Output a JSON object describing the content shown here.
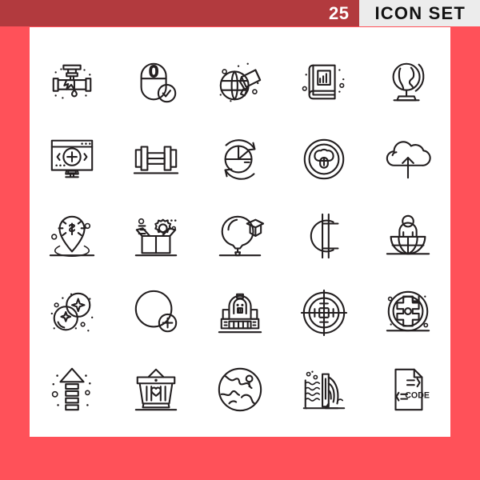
{
  "header": {
    "count": "25",
    "title": "ICON SET",
    "count_bg": "#b23a3e",
    "title_bg": "#ececec",
    "title_color": "#121212"
  },
  "page": {
    "background_color": "#ff5159",
    "panel_color": "#ffffff",
    "icon_stroke_color": "#231f20"
  },
  "grid": {
    "columns": 5,
    "rows": 5,
    "total_icons": 25
  },
  "icons": [
    {
      "index": 1,
      "name": "broken-pipe-leak-icon",
      "label": "Broken Pipe Leak"
    },
    {
      "index": 2,
      "name": "mouse-check-icon",
      "label": "Computer Mouse Verified"
    },
    {
      "index": 3,
      "name": "globe-megaphone-icon",
      "label": "Global Announcement"
    },
    {
      "index": 4,
      "name": "book-chart-icon",
      "label": "Statistics Book"
    },
    {
      "index": 5,
      "name": "desk-globe-icon",
      "label": "Desk Globe"
    },
    {
      "index": 6,
      "name": "monitor-add-icon",
      "label": "Monitor Add"
    },
    {
      "index": 7,
      "name": "dumbbell-icon",
      "label": "Dumbbell"
    },
    {
      "index": 8,
      "name": "pie-chart-refresh-icon",
      "label": "Pie Chart Refresh"
    },
    {
      "index": 9,
      "name": "face-coin-icon",
      "label": "Circular Face Badge"
    },
    {
      "index": 10,
      "name": "cloud-upload-icon",
      "label": "Cloud Upload"
    },
    {
      "index": 11,
      "name": "dollar-location-pin-icon",
      "label": "Money Location"
    },
    {
      "index": 12,
      "name": "box-gear-icon",
      "label": "Package Settings"
    },
    {
      "index": 13,
      "name": "balloon-graduation-icon",
      "label": "Graduation Balloon"
    },
    {
      "index": 14,
      "name": "cent-currency-icon",
      "label": "Cent Currency"
    },
    {
      "index": 15,
      "name": "person-globe-desk-icon",
      "label": "Global Worker"
    },
    {
      "index": 16,
      "name": "sparkle-bubbles-icon",
      "label": "Sparkling Bubbles"
    },
    {
      "index": 17,
      "name": "circle-add-icon",
      "label": "Add Circle"
    },
    {
      "index": 18,
      "name": "robot-machine-icon",
      "label": "Robot Machine"
    },
    {
      "index": 19,
      "name": "crosshair-target-icon",
      "label": "Crosshair Target"
    },
    {
      "index": 20,
      "name": "gear-wheel-icon",
      "label": "Gear Wheel"
    },
    {
      "index": 21,
      "name": "upload-arrow-icon",
      "label": "Upload Arrow"
    },
    {
      "index": 22,
      "name": "shopping-basket-love-icon",
      "label": "Favourite Basket"
    },
    {
      "index": 23,
      "name": "earth-globe-icon",
      "label": "Earth Globe"
    },
    {
      "index": 24,
      "name": "waterfall-dam-icon",
      "label": "Dam Waterfall"
    },
    {
      "index": 25,
      "name": "code-file-icon",
      "label": "Code File",
      "text": "CODE"
    }
  ]
}
